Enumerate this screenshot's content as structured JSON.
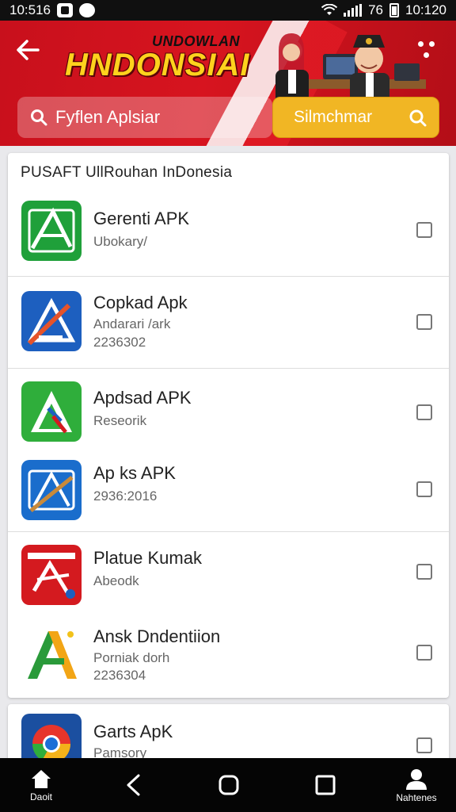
{
  "status_bar": {
    "time_left": "10:516",
    "time_right": "10:120",
    "battery_text": "76"
  },
  "header": {
    "subtitle": "UNDOWLAN",
    "title": "HNDONSIAI",
    "search": {
      "placeholder": "Fyflen Aplsiar"
    },
    "search_button_label": "Silmchmar",
    "colors": {
      "primary": "#d7141f",
      "accent": "#f1b624",
      "title": "#ffd21d"
    }
  },
  "list": {
    "section_title": "PUSAFT UllRouhan InDonesia",
    "apps": [
      {
        "name": "Gerenti APK",
        "meta1": "Ubokary/",
        "meta2": "",
        "icon": "green-apk-icon",
        "color": "#1fa03a",
        "checked": false
      },
      {
        "name": "Copkad Apk",
        "meta1": "Andarari /ark",
        "meta2": "2236302",
        "icon": "blue-apk-icon",
        "color": "#1d5fbf",
        "checked": false
      },
      {
        "name": "Apdsad APK",
        "meta1": "Reseorik",
        "meta2": "",
        "icon": "green-a-icon",
        "color": "#2fae3b",
        "checked": false
      },
      {
        "name": "Ap ks APK",
        "meta1": "2936:2016",
        "meta2": "",
        "icon": "blue-pen-icon",
        "color": "#1a6dcc",
        "checked": false
      },
      {
        "name": "Platue Kumak",
        "meta1": "Abeodk",
        "meta2": "",
        "icon": "red-apk-icon",
        "color": "#d41a1f",
        "checked": false
      },
      {
        "name": "Ansk Dndentiion",
        "meta1": "Porniak dorh",
        "meta2": "2236304",
        "icon": "a-logo-icon",
        "color": "#2a9a3a",
        "checked": false
      },
      {
        "name": "Garts ApK",
        "meta1": "Pamsory",
        "meta2": "",
        "icon": "chrome-like-icon",
        "color": "#1b4fa0",
        "checked": false
      }
    ]
  },
  "nav": {
    "home_label": "Daoit",
    "profile_label": "Nahtenes"
  }
}
